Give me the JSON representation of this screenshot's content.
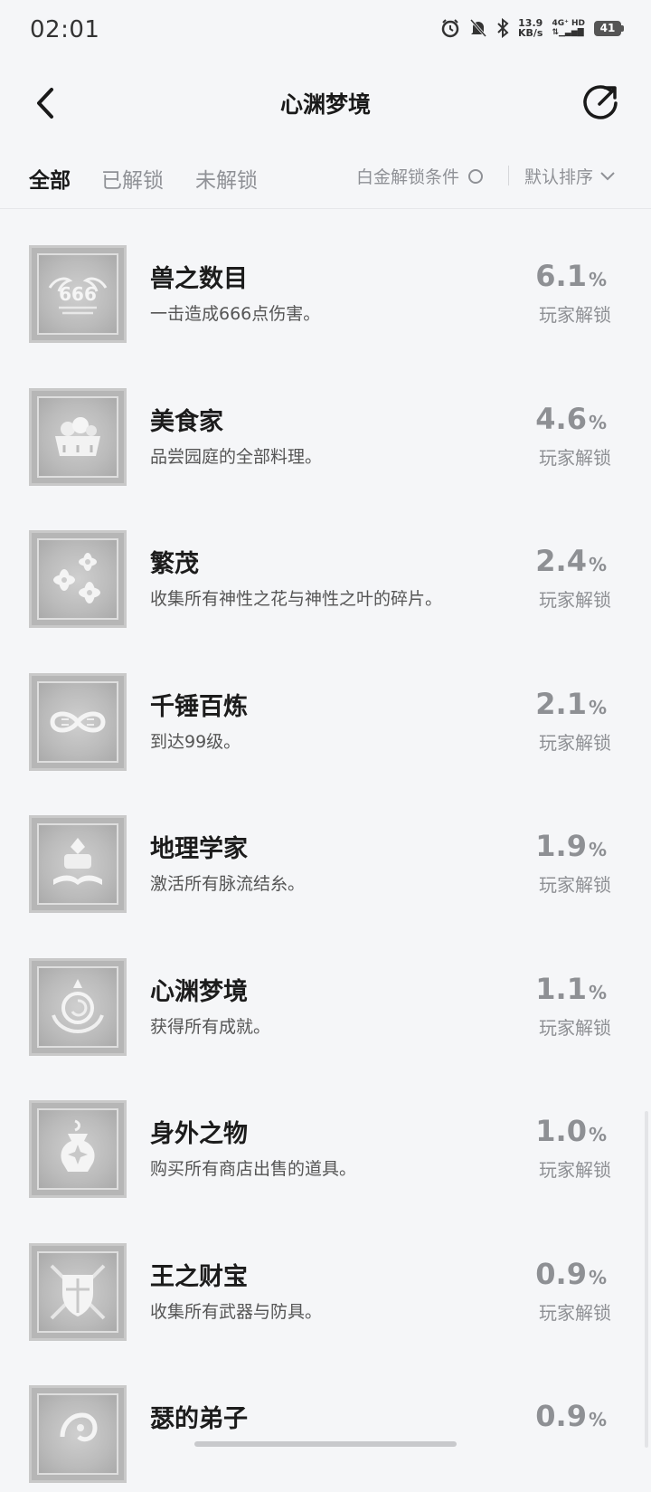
{
  "status_bar": {
    "time": "02:01",
    "net_speed_value": "13.9",
    "net_speed_unit": "KB/s",
    "net_type_top": "4G⁺ HD",
    "net_type_bottom": "⇅▁▃▅▇",
    "battery": "41",
    "icons": [
      "alarm-icon",
      "mute-icon",
      "bluetooth-icon",
      "signal-icon",
      "battery-icon"
    ]
  },
  "header": {
    "title": "心渊梦境",
    "back_icon": "chevron-left-icon",
    "share_icon": "share-icon"
  },
  "filters": {
    "tabs": [
      "全部",
      "已解锁",
      "未解锁"
    ],
    "active_tab": "全部",
    "platinum_condition": "白金解锁条件",
    "sort": "默认排序"
  },
  "achievements": [
    {
      "name": "兽之数目",
      "desc": "一击造成666点伤害。",
      "pct": "6.1",
      "unit": "%",
      "label": "玩家解锁",
      "icon": "666-wings-icon"
    },
    {
      "name": "美食家",
      "desc": "品尝园庭的全部料理。",
      "pct": "4.6",
      "unit": "%",
      "label": "玩家解锁",
      "icon": "food-basket-icon"
    },
    {
      "name": "繁茂",
      "desc": "收集所有神性之花与神性之叶的碎片。",
      "pct": "2.4",
      "unit": "%",
      "label": "玩家解锁",
      "icon": "flowers-icon"
    },
    {
      "name": "千锤百炼",
      "desc": "到达99级。",
      "pct": "2.1",
      "unit": "%",
      "label": "玩家解锁",
      "icon": "infinity-icon"
    },
    {
      "name": "地理学家",
      "desc": "激活所有脉流结糸。",
      "pct": "1.9",
      "unit": "%",
      "label": "玩家解锁",
      "icon": "map-book-icon"
    },
    {
      "name": "心渊梦境",
      "desc": "获得所有成就。",
      "pct": "1.1",
      "unit": "%",
      "label": "玩家解锁",
      "icon": "dream-orb-icon"
    },
    {
      "name": "身外之物",
      "desc": "购买所有商店出售的道具。",
      "pct": "1.0",
      "unit": "%",
      "label": "玩家解锁",
      "icon": "urn-icon"
    },
    {
      "name": "王之财宝",
      "desc": "收集所有武器与防具。",
      "pct": "0.9",
      "unit": "%",
      "label": "玩家解锁",
      "icon": "armor-icon"
    },
    {
      "name": "瑟的弟子",
      "desc": "",
      "pct": "0.9",
      "unit": "%",
      "label": "",
      "icon": "disciple-icon"
    }
  ]
}
